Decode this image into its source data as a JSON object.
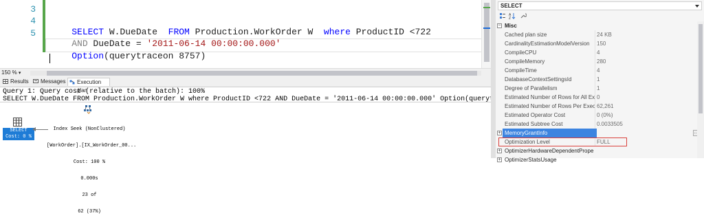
{
  "editor": {
    "line_numbers": [
      "3",
      "4",
      "5"
    ],
    "line3": {
      "kw1": "SELECT",
      "p1": " W.DueDate  ",
      "kw2": "FROM",
      "p2": " Production.WorkOrder W  ",
      "kw3": "where",
      "p3": " ProductID <722"
    },
    "line4": {
      "kw1": "AND",
      "p1": " DueDate = ",
      "str": "'2011-06-14 00:00:00.000'"
    },
    "line5": {
      "kw1": "Option",
      "p1": "(querytraceon 8757)"
    }
  },
  "zoom_level": "150 %",
  "results_tabs": [
    {
      "label": "Results"
    },
    {
      "label": "Messages"
    },
    {
      "label": "Execution plan"
    }
  ],
  "plan": {
    "query_header": "Query 1: Query cost (relative to the batch): 100%",
    "query_sql": "SELECT W.DueDate FROM Production.WorkOrder W where ProductID <722 AND DueDate = '2011-06-14 00:00:00.000' Option(querytraceon...",
    "select_node": {
      "label": "SELECT",
      "cost": "Cost: 0 %"
    },
    "seek_node": {
      "line1": "Index Seek (NonClustered)",
      "line2": "[WorkOrder].[IX_WorkOrder_00...",
      "line3": "Cost: 100 %",
      "line4": "0.000s",
      "line5": "23 of",
      "line6": "62 (37%)"
    }
  },
  "properties": {
    "selected_object": "SELECT",
    "category": "Misc",
    "rows": [
      {
        "name": "Cached plan size",
        "value": "24 KB"
      },
      {
        "name": "CardinalityEstimationModelVersion",
        "value": "150"
      },
      {
        "name": "CompileCPU",
        "value": "4"
      },
      {
        "name": "CompileMemory",
        "value": "280"
      },
      {
        "name": "CompileTime",
        "value": "4"
      },
      {
        "name": "DatabaseContextSettingsId",
        "value": "1"
      },
      {
        "name": "Degree of Parallelism",
        "value": "1"
      },
      {
        "name": "Estimated Number of Rows for All Exe",
        "value": "0"
      },
      {
        "name": "Estimated Number of Rows Per Execu",
        "value": "62,261"
      },
      {
        "name": "Estimated Operator Cost",
        "value": "0 (0%)"
      },
      {
        "name": "Estimated Subtree Cost",
        "value": "0.0033505"
      }
    ],
    "memory_grant": {
      "name": "MemoryGrantInfo",
      "value": ""
    },
    "optimization_level": {
      "name": "Optimization Level",
      "value": "FULL"
    },
    "hw_props": {
      "name": "OptimizerHardwareDependentPrope",
      "value": ""
    },
    "stats_usage": {
      "name": "OptimizerStatsUsage",
      "value": ""
    }
  },
  "colors": {
    "keyword": "#0000ff",
    "string": "#a31515",
    "line_number": "#2b91af",
    "selection": "#3c84e0",
    "highlight_border": "#d9403b"
  }
}
